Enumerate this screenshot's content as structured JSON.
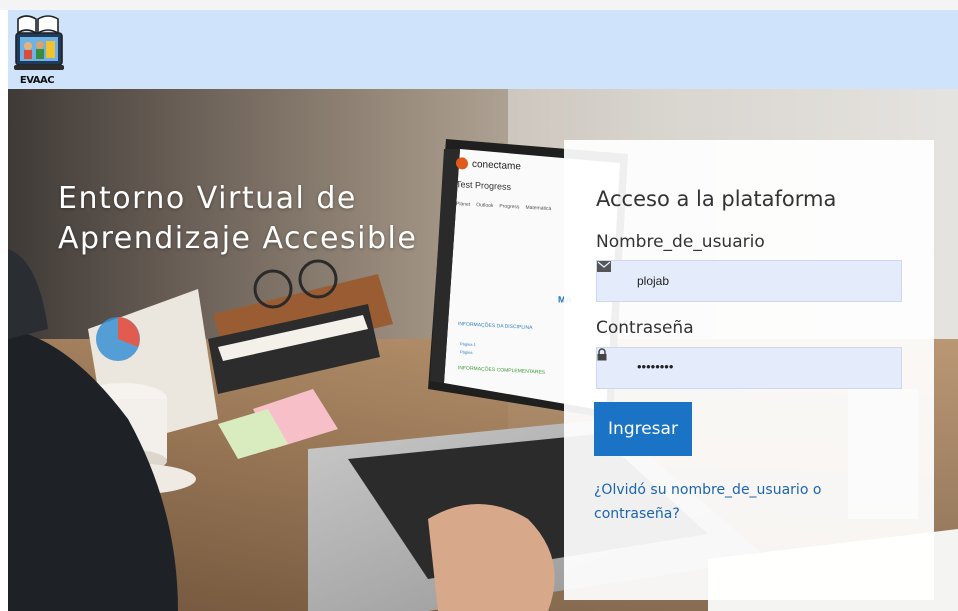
{
  "header": {
    "logo_text": "EVAAC"
  },
  "hero": {
    "title_line1": "Entorno Virtual de",
    "title_line2": "Aprendizaje Accesible",
    "laptop_screen": {
      "brand": "conectame",
      "page_title": "Test Progress",
      "tabs": [
        "Planet",
        "Outlook",
        "Progress",
        "Matemática"
      ],
      "section1": "INFORMAÇÕES DA DISCIPLINA",
      "link1": "Página 1",
      "link2": "Página",
      "section2": "INFORMAÇÕES COMPLEMENTARES",
      "right_fragment": "MA"
    }
  },
  "login": {
    "title": "Acceso a la plataforma",
    "username_label": "Nombre_de_usuario",
    "username_value": "plojab",
    "password_label": "Contraseña",
    "password_value": "••••••••",
    "submit_label": "Ingresar",
    "forgot_line1": "¿Olvidó su nombre_de_usuario o",
    "forgot_line2": "contraseña?"
  },
  "colors": {
    "header_bg": "#cfe3fb",
    "button_bg": "#1a73c4",
    "link": "#1d65b0",
    "input_bg": "#e4ebfb"
  },
  "icons": [
    "envelope-icon",
    "lock-icon"
  ]
}
